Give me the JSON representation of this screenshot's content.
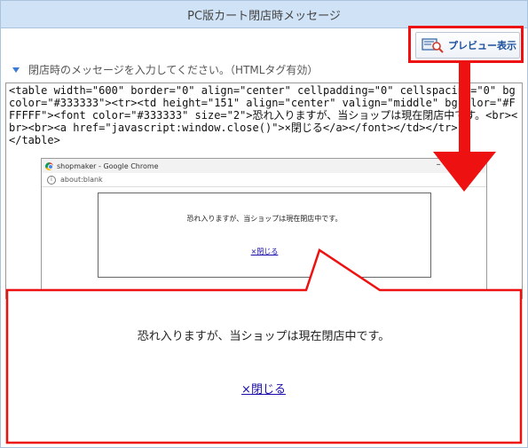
{
  "window": {
    "title": "PC版カート閉店時メッセージ"
  },
  "toolbar": {
    "preview_label": "プレビュー表示"
  },
  "section": {
    "instruction": "閉店時のメッセージを入力してください。（HTMLタグ有効）"
  },
  "editor": {
    "html_source": "<table width=\"600\" border=\"0\" align=\"center\" cellpadding=\"0\" cellspacing=\"0\" bgcolor=\"#333333\"><tr><td height=\"151\" align=\"center\" valign=\"middle\" bgcolor=\"#FFFFFF\"><font color=\"#333333\" size=\"2\">恐れ入りますが、当ショップは現在閉店中です。<br><br><br><a href=\"javascript:window.close()\">×閉じる</a></font></td></tr>\n</table>"
  },
  "browser": {
    "title": "shopmaker - Google Chrome",
    "address": "about:blank",
    "message": "恐れ入りますが、当ショップは現在閉店中です。",
    "close_link": "×閉じる"
  },
  "zoom": {
    "message": "恐れ入りますが、当ショップは現在閉店中です。",
    "close_link": "×閉じる"
  },
  "colors": {
    "title_bar": "#cfe2f6",
    "highlight": "#ee1111",
    "link": "#1a0dab"
  }
}
